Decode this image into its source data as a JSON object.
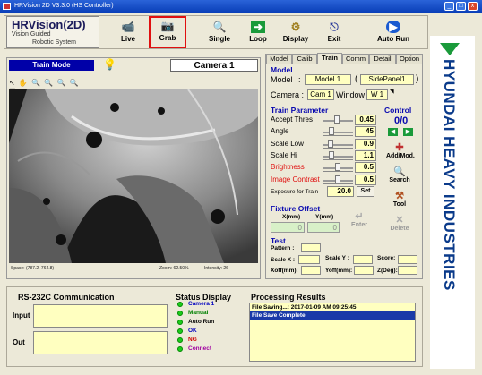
{
  "window": {
    "title": "HRVision 2D V3.3.0 (HS Controller)",
    "minimize": "_",
    "maximize": "□",
    "close": "x"
  },
  "logo": {
    "title": "HRVision(2D)",
    "sub1": "Vision Guided",
    "sub2": "Robotic System"
  },
  "toolbar": [
    {
      "label": "Live",
      "icon": "camcorder-icon",
      "glyph": "📹"
    },
    {
      "label": "Grab",
      "icon": "camera-icon",
      "glyph": "📷"
    },
    {
      "label": "Single",
      "icon": "magnifier-icon",
      "glyph": "🔍"
    },
    {
      "label": "Loop",
      "icon": "arrow-right-icon",
      "glyph": "➜"
    },
    {
      "label": "Display",
      "icon": "gear-icon",
      "glyph": "⚙"
    },
    {
      "label": "Exit",
      "icon": "exit-door-icon",
      "glyph": "⎋"
    },
    {
      "label": "Auto Run",
      "icon": "play-icon",
      "glyph": "▶"
    }
  ],
  "left": {
    "mode": "Train Mode",
    "camera_title": "Camera 1",
    "tools": "↖ ✋ 🔍 🔍 🔍 🔍 ▦",
    "status_pos": "Space: (787.2, 764.8)",
    "status_zoom": "Zoom: 62.50%",
    "status_intensity": "Intensity: 26"
  },
  "tabs": [
    "Model",
    "Calib",
    "Train",
    "Comm",
    "Detail",
    "Option"
  ],
  "active_tab": "Train",
  "model": {
    "title": "Model",
    "model_label": "Model",
    "colon": ":",
    "model_value": "Model 1",
    "panel_value": "SidePanel1",
    "paren_open": "(",
    "paren_close": ")",
    "camera_label": "Camera :",
    "camera_value": "Cam 1",
    "window_label": "Window :",
    "window_value": "W 1"
  },
  "train_params": {
    "title": "Train Parameter",
    "rows": [
      {
        "label": "Accept Thres",
        "value": "0.45",
        "slider": 0.45,
        "red": false
      },
      {
        "label": "Angle",
        "value": "45",
        "slider": 0.25,
        "red": false
      },
      {
        "label": "Scale Low",
        "value": "0.9",
        "slider": 0.2,
        "red": false
      },
      {
        "label": "Scale Hi",
        "value": "1.1",
        "slider": 0.25,
        "red": false
      },
      {
        "label": "Brightness",
        "value": "0.5",
        "slider": 0.5,
        "red": true
      },
      {
        "label": "Image Contrast",
        "value": "0.5",
        "slider": 0.5,
        "red": true
      }
    ],
    "exposure_label": "Exposure for Train",
    "exposure_value": "20.0",
    "set_label": "Set"
  },
  "control": {
    "title": "Control",
    "count": "0/0",
    "add_label": "Add/Mod.",
    "search_label": "Search",
    "tool_label": "Tool",
    "delete_label": "Delete"
  },
  "fixture": {
    "title": "Fixture Offset",
    "x_label": "X(mm)",
    "y_label": "Y(mm)",
    "x_value": "0",
    "y_value": "0",
    "enter_label": "Enter"
  },
  "test": {
    "title": "Test",
    "pattern_label": "Pattern :",
    "scalex_label": "Scale X :",
    "scaley_label": "Scale Y :",
    "score_label": "Score:",
    "xoff_label": "Xoff(mm):",
    "yoff_label": "Yoff(mm):",
    "z_label": "Z(Deg):"
  },
  "rs232": {
    "title": "RS-232C Communication",
    "input_label": "Input",
    "out_label": "Out"
  },
  "status_display": {
    "title": "Status Display",
    "items": [
      {
        "label": "Camera 1",
        "color": "#0000c0"
      },
      {
        "label": "Manual",
        "color": "#008000"
      },
      {
        "label": "Auto Run",
        "color": "#000000"
      },
      {
        "label": "OK",
        "color": "#0000c0"
      },
      {
        "label": "NG",
        "color": "#d00000"
      },
      {
        "label": "Connect",
        "color": "#a000a0"
      }
    ]
  },
  "processing": {
    "title": "Processing Results",
    "lines": [
      "File Saving...: 2017-01-09 AM 09:25:45",
      "File Save Complete"
    ]
  },
  "brand": {
    "text": "HYUNDAI HEAVY INDUSTRIES",
    "color": "#0a3a8a"
  }
}
